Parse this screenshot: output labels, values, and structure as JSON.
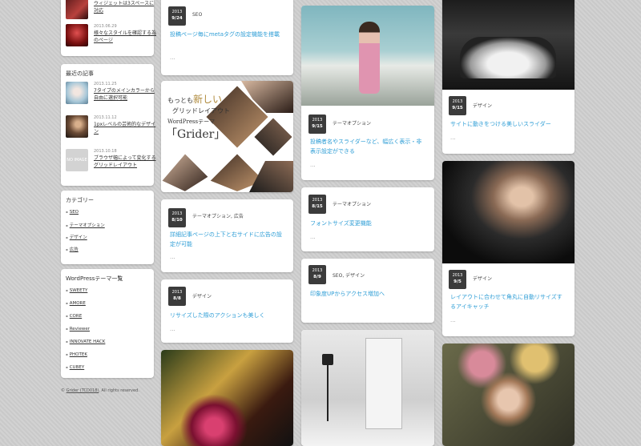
{
  "sidebar": {
    "top_partial": [
      {
        "title": "ウィジェットは3スペースに対応",
        "date": ""
      },
      {
        "title": "様々なスタイルを確認する為のページ",
        "date": "2013.06.29"
      }
    ],
    "recent": {
      "heading": "最近の記事",
      "posts": [
        {
          "date": "2013.11.25",
          "title": "7タイプのメインカラーから自由に選択可能",
          "thumb": "face"
        },
        {
          "date": "2013.11.12",
          "title": "1pxレベルの芸術的なデザイン",
          "thumb": "face2"
        },
        {
          "date": "2013.10.18",
          "title": "ブラウザ幅によって変化するグリッドレイアウト",
          "thumb": "noimage"
        }
      ],
      "noimage_label": "NO IMAGE"
    },
    "categories": {
      "heading": "カテゴリー",
      "items": [
        "SEO",
        "テーマオプション",
        "デザイン",
        "広告"
      ]
    },
    "themes": {
      "heading": "WordPressテーマ一覧",
      "items": [
        "SWEETY",
        "AMORE",
        "CORE",
        "Reviewer",
        "INNOVATE HACK",
        "PHOTEK",
        "CUBEY"
      ]
    },
    "copyright_prefix": "© ",
    "copyright_link": "Grider (TCD018)",
    "copyright_suffix": ". All rights reserved."
  },
  "banner": {
    "line1": "もっとも",
    "line1b": "新しい",
    "line2": "グリッドレイアウト",
    "line3": "WordPressテーマ",
    "line4": "「Grider」"
  },
  "posts": {
    "p1": {
      "year": "2013",
      "md": "9/24",
      "category": "SEO",
      "title": "投稿ページ毎にmetaタグの設定機能を搭載",
      "more": "..."
    },
    "p2": {
      "year": "2013",
      "md": "8/10",
      "category": "テーマオプション, 広告",
      "title": "詳細記事ページの上下と右サイドに広告の設定が可能",
      "more": "..."
    },
    "p3": {
      "year": "2013",
      "md": "8/8",
      "category": "デザイン",
      "title": "リサイズした際のアクションも美しく",
      "more": "..."
    },
    "p4": {
      "year": "2013",
      "md": "9/15",
      "category": "テーマオプション",
      "title": "投稿者名やスライダーなど、幅広く表示・非表示設定ができる",
      "more": "..."
    },
    "p5": {
      "year": "2013",
      "md": "8/15",
      "category": "テーマオプション",
      "title": "フォントサイズ変更機能",
      "more": "..."
    },
    "p6": {
      "year": "2013",
      "md": "8/9",
      "category": "SEO, デザイン",
      "title": "印象度UPからアクセス増加へ",
      "more": ""
    },
    "p7": {
      "year": "2013",
      "md": "9/15",
      "category": "デザイン",
      "title": "サイトに動きをつける美しいスライダー",
      "more": "..."
    },
    "p8": {
      "year": "2013",
      "md": "9/5",
      "category": "デザイン",
      "title": "レイアウトに合わせて角丸に自動リサイズするアイキャッチ",
      "more": "..."
    }
  }
}
